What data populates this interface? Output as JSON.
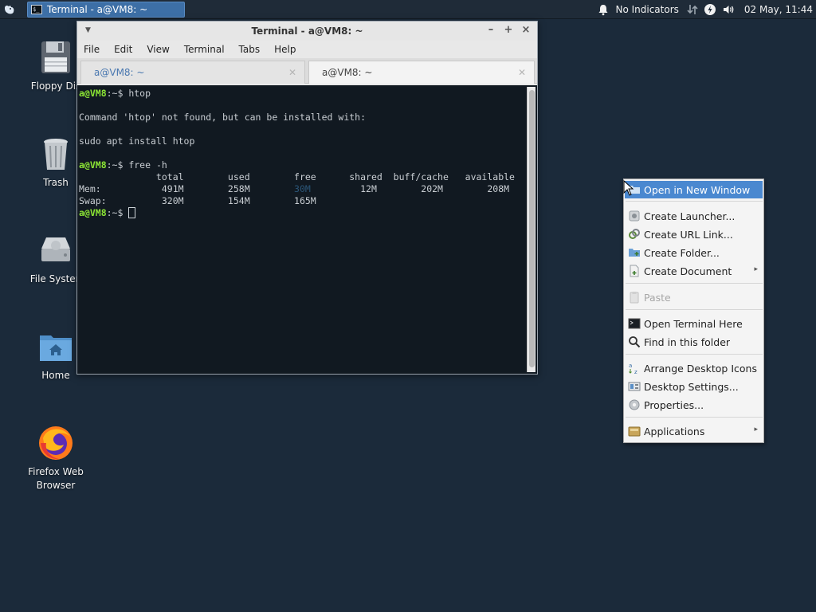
{
  "panel": {
    "task_button_label": "Terminal - a@VM8: ~",
    "no_indicators": "No Indicators",
    "clock": "02 May, 11:44"
  },
  "desktop": {
    "icons": [
      {
        "label": "Floppy Dis"
      },
      {
        "label": "Trash"
      },
      {
        "label": "File Systen"
      },
      {
        "label": "Home"
      },
      {
        "label": "Firefox Web",
        "label2": "Browser"
      }
    ]
  },
  "terminal": {
    "window_title": "Terminal - a@VM8: ~",
    "menu": [
      "File",
      "Edit",
      "View",
      "Terminal",
      "Tabs",
      "Help"
    ],
    "tabs": [
      {
        "label": "a@VM8: ~"
      },
      {
        "label": "a@VM8: ~"
      }
    ],
    "prompt_user": "a@VM8",
    "prompt_path": ":~$ ",
    "lines": {
      "cmd1": "htop",
      "err": "Command 'htop' not found, but can be installed with:",
      "sugg": "sudo apt install htop",
      "cmd2": "free -h",
      "header": "              total        used        free      shared  buff/cache   available",
      "mem_a": "Mem:           491M        258M        ",
      "mem_free": "30M",
      "mem_b": "         12M        202M        208M",
      "swap": "Swap:          320M        154M        165M"
    }
  },
  "context_menu": {
    "items": {
      "open_new_window": "Open in New Window",
      "create_launcher": "Create Launcher...",
      "create_url_link": "Create URL Link...",
      "create_folder": "Create Folder...",
      "create_document": "Create Document",
      "paste": "Paste",
      "open_terminal_here": "Open Terminal Here",
      "find_in_folder": "Find in this folder",
      "arrange_icons": "Arrange Desktop Icons",
      "desktop_settings": "Desktop Settings...",
      "properties": "Properties...",
      "applications": "Applications"
    }
  },
  "colors": {
    "desktop_bg": "#1b2a3a",
    "panel_bg": "#1f2b38",
    "highlight": "#4a88d0",
    "terminal_bg": "#111921",
    "prompt_green": "#8ae234"
  }
}
